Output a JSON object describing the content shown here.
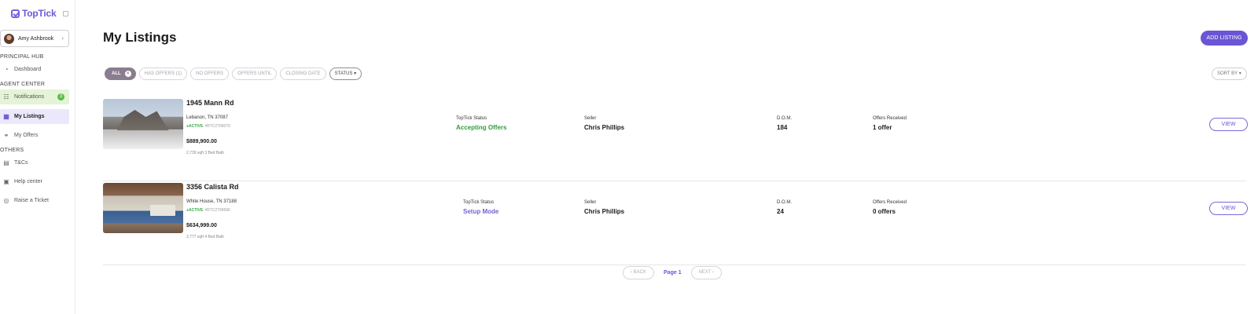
{
  "brand": {
    "name": "TopTick",
    "accent": "#6a55d4"
  },
  "user": {
    "name": "Amy Ashbrook"
  },
  "sidebar": {
    "sections": [
      {
        "title": "PRINCIPAL HUB"
      },
      {
        "title": "AGENT CENTER"
      },
      {
        "title": "OTHERS"
      }
    ],
    "items": [
      {
        "label": "Dashboard",
        "icon": "dashboard-icon"
      },
      {
        "label": "Notifications",
        "icon": "notifications-icon",
        "badge": "3"
      },
      {
        "label": "My Listings",
        "icon": "listings-icon",
        "active": true
      },
      {
        "label": "My Offers",
        "icon": "offers-icon"
      },
      {
        "label": "T&Cs",
        "icon": "document-icon"
      },
      {
        "label": "Help center",
        "icon": "help-icon"
      },
      {
        "label": "Raise a Ticket",
        "icon": "ticket-icon"
      }
    ]
  },
  "header": {
    "title": "My Listings",
    "add_label": "ADD LISTING"
  },
  "filters": {
    "chips": [
      "ALL",
      "HAS OFFERS (1)",
      "NO OFFERS",
      "OFFERS UNTIL",
      "CLOSING DATE",
      "STATUS"
    ],
    "selected": "ALL",
    "sort_label": "SORT BY"
  },
  "listings": [
    {
      "address": "1945 Mann Rd",
      "city": "Lebanon, TN 37087",
      "status_tag": "●ACTIVE",
      "mls": "#RTC2709079",
      "price": "$889,900.00",
      "specs": "2,739 sqft 3 Bed Bath",
      "toptick_status_label": "TopTick Status",
      "toptick_status": "Accepting Offers",
      "seller_label": "Seller",
      "seller": "Chris Phillips",
      "dom_label": "D.O.M.",
      "dom": "184",
      "offers_label": "Offers Received",
      "offers": "1 offer",
      "view_label": "VIEW"
    },
    {
      "address": "3356 Calista Rd",
      "city": "White House, TN 37188",
      "status_tag": "●ACTIVE",
      "mls": "#RTC2799696",
      "price": "$634,999.00",
      "specs": "2,777 sqft 4 Bed Bath",
      "toptick_status_label": "TopTick Status",
      "toptick_status": "Setup Mode",
      "seller_label": "Seller",
      "seller": "Chris Phillips",
      "dom_label": "D.O.M.",
      "dom": "24",
      "offers_label": "Offers Received",
      "offers": "0 offers",
      "view_label": "VIEW"
    }
  ],
  "pagination": {
    "back_label": "‹ BACK",
    "page_label": "Page 1",
    "next_label": "NEXT ›"
  }
}
